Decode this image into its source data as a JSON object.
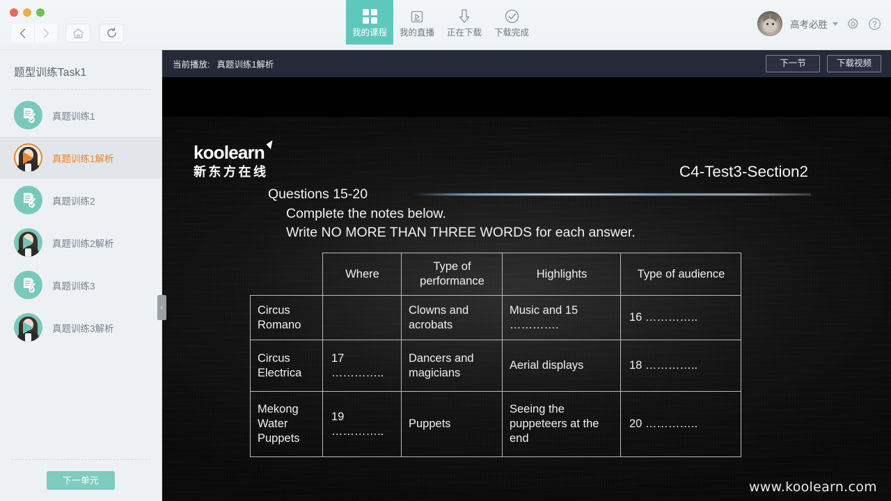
{
  "window": {
    "traffic_lights": [
      "close",
      "minimize",
      "maximize"
    ],
    "nav": {
      "back": "back-arrow",
      "forward": "forward-arrow",
      "home": "home-icon",
      "reload": "reload-icon"
    }
  },
  "header": {
    "tabs": [
      {
        "label": "我的课程",
        "icon": "grid-squares-icon",
        "active": true
      },
      {
        "label": "我的直播",
        "icon": "live-play-icon",
        "active": false
      },
      {
        "label": "正在下载",
        "icon": "download-arrow-icon",
        "active": false
      },
      {
        "label": "下载完成",
        "icon": "check-circle-icon",
        "active": false
      }
    ],
    "user": {
      "name": "高考必胜",
      "avatar": "cat-avatar",
      "settings_icon": "gear-icon",
      "help_icon": "help-circle-icon"
    },
    "accent": "#5ec8bd"
  },
  "sidebar": {
    "title": "题型训练Task1",
    "items": [
      {
        "label": "真题训练1",
        "icon": "note-check-icon",
        "active": false
      },
      {
        "label": "真题训练1解析",
        "icon": "teacher-play-icon",
        "active": true
      },
      {
        "label": "真题训练2",
        "icon": "note-check-icon",
        "active": false
      },
      {
        "label": "真题训练2解析",
        "icon": "teacher-play-icon",
        "active": false
      },
      {
        "label": "真题训练3",
        "icon": "note-check-icon",
        "active": false
      },
      {
        "label": "真题训练3解析",
        "icon": "teacher-play-icon",
        "active": false
      }
    ],
    "next_unit_label": "下一单元",
    "collapse_handle": "‹",
    "active_color": "#e8852a"
  },
  "player": {
    "now_playing_prefix": "当前播放:",
    "now_playing_title": "真题训练1解析",
    "next_section_label": "下一节",
    "download_video_label": "下载视频"
  },
  "slide": {
    "logo_word": "koolearn",
    "logo_cn": "新东方在线",
    "test_code": "C4-Test3-Section2",
    "question_range": "Questions 15-20",
    "instruction_1": "Complete the notes below.",
    "instruction_2": "Write NO MORE THAN THREE WORDS for each answer.",
    "watermark": "www.koolearn.com",
    "table": {
      "headers": [
        "",
        "Where",
        "Type of\nperformance",
        "Highlights",
        "Type of audience"
      ],
      "header_0": "",
      "header_1": "Where",
      "header_2a": "Type of",
      "header_2b": "performance",
      "header_3": "Highlights",
      "header_4": "Type of audience",
      "rows": [
        {
          "name": "Circus\nRomano",
          "name_a": "Circus",
          "name_b": "Romano",
          "where": "",
          "performance_a": "Clowns and",
          "performance_b": "acrobats",
          "highlights_a": "Music and 15",
          "highlights_b": "………….",
          "audience": "16 ………….."
        },
        {
          "name_a": "Circus",
          "name_b": "Electrica",
          "where": "17 …………..",
          "performance_a": "Dancers and",
          "performance_b": "magicians",
          "highlights_a": "Aerial displays",
          "highlights_b": "",
          "audience": "18 ………….."
        },
        {
          "name_a": "Mekong",
          "name_b": "Water",
          "name_c": "Puppets",
          "where": "19 …………..",
          "performance_a": "Puppets",
          "performance_b": "",
          "highlights_a": "Seeing the",
          "highlights_b": "puppeteers  at the",
          "highlights_c": "end",
          "audience": "20 ………….."
        }
      ]
    }
  }
}
